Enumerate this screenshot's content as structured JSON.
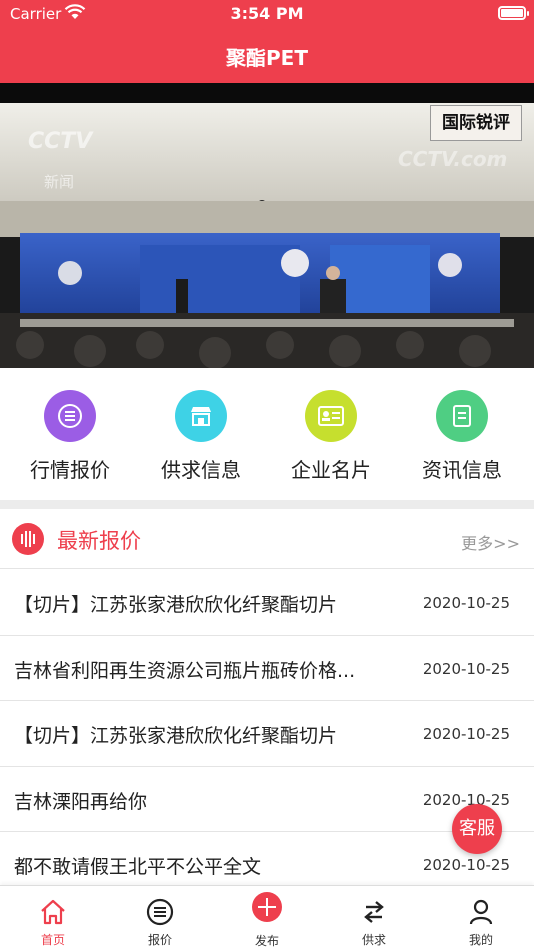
{
  "status_bar": {
    "carrier": "Carrier",
    "time": "3:54 PM"
  },
  "header": {
    "title": "聚酯PET"
  },
  "banner": {
    "badge": "国际锐评",
    "watermark": "CCTV",
    "watermark_channel": "新闻",
    "watermark_site": "CCTV.com"
  },
  "quick_links": [
    {
      "label": "行情报价",
      "icon": "list-icon",
      "color": "#9b5de5"
    },
    {
      "label": "供求信息",
      "icon": "store-icon",
      "color": "#3ed2e6"
    },
    {
      "label": "企业名片",
      "icon": "id-card-icon",
      "color": "#c6df2e"
    },
    {
      "label": "资讯信息",
      "icon": "document-icon",
      "color": "#4fce83"
    }
  ],
  "latest": {
    "title": "最新报价",
    "more": "更多>>",
    "items": [
      {
        "title": "【切片】江苏张家港欣欣化纤聚酯切片",
        "date": "2020-10-25"
      },
      {
        "title": "吉林省利阳再生资源公司瓶片瓶砖价格...",
        "date": "2020-10-25"
      },
      {
        "title": "【切片】江苏张家港欣欣化纤聚酯切片",
        "date": "2020-10-25"
      },
      {
        "title": "吉林溧阳再给你",
        "date": "2020-10-25"
      },
      {
        "title": "都不敢请假王北平不公平全文",
        "date": "2020-10-25"
      }
    ]
  },
  "floating": {
    "service": "客服"
  },
  "tabs": [
    {
      "label": "首页",
      "active": true
    },
    {
      "label": "报价"
    },
    {
      "label": "发布"
    },
    {
      "label": "供求"
    },
    {
      "label": "我的"
    }
  ],
  "colors": {
    "brand": "#ee3f4d"
  }
}
